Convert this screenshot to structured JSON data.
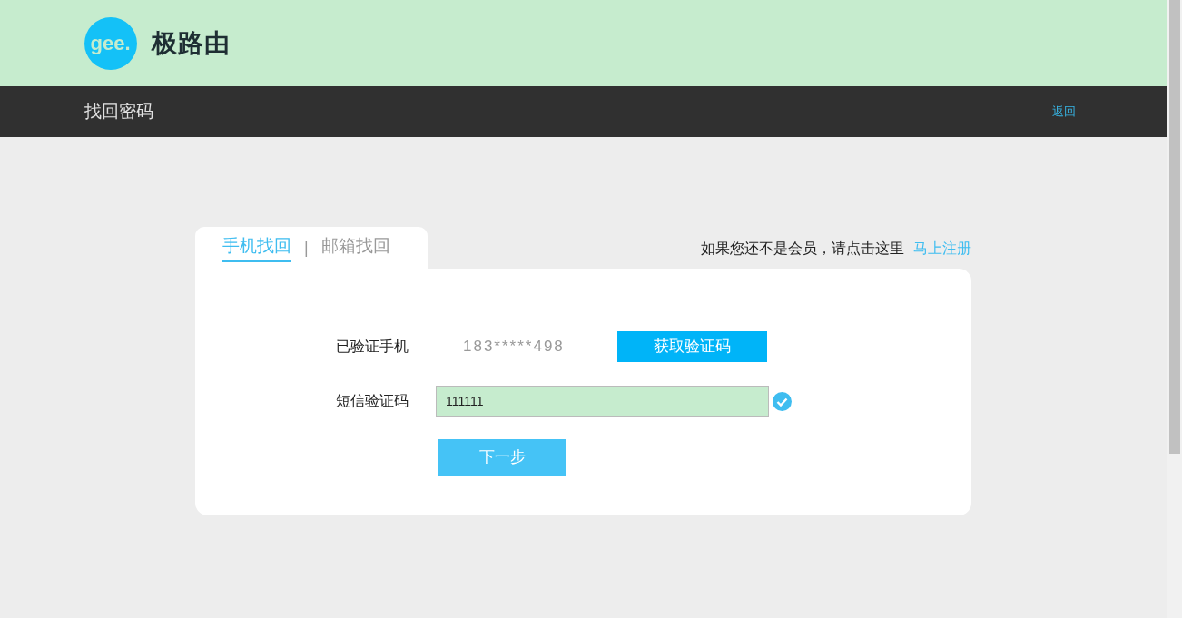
{
  "header": {
    "logo_text": "gee.",
    "brand": "极路由"
  },
  "nav": {
    "title": "找回密码",
    "back_link": "返回"
  },
  "tabs": [
    {
      "label": "手机找回",
      "selected": true
    },
    {
      "label": "邮箱找回",
      "selected": false
    }
  ],
  "tab_separator": "|",
  "register_prompt": {
    "text": "如果您还不是会员，请点击这里",
    "link": "马上注册"
  },
  "form": {
    "phone_label": "已验证手机",
    "phone_value": "183*****498",
    "get_code_button": "获取验证码",
    "code_label": "短信验证码",
    "code_value": "111111",
    "code_verified": true,
    "next_button": "下一步"
  }
}
